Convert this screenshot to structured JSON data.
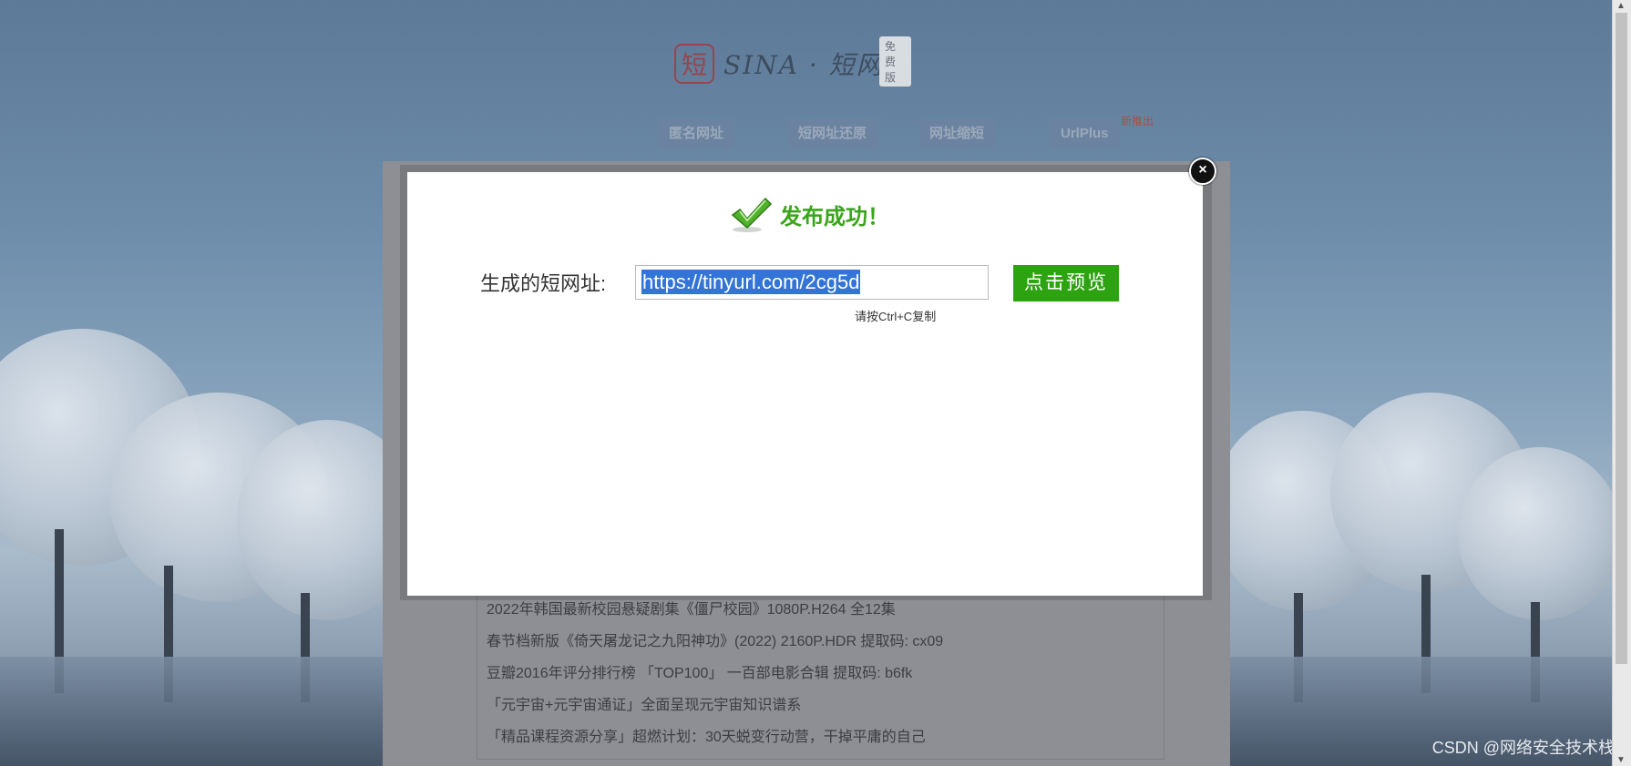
{
  "logo": {
    "mark": "短",
    "text": "SINA · 短网址",
    "badge": "免费版"
  },
  "nav": {
    "items": [
      "匿名网址",
      "短网址还原",
      "网址缩短",
      "UrlPlus"
    ],
    "new_badge": "新推出"
  },
  "modal": {
    "success_text": "发布成功！",
    "url_label": "生成的短网址:",
    "url_value": "https://tinyurl.com/2cg5d",
    "preview_button": "点击预览",
    "copy_hint": "请按Ctrl+C复制",
    "close_symbol": "×"
  },
  "list": {
    "items": [
      "2022年韩国最新校园悬疑剧集《僵尸校园》1080P.H264 全12集",
      "春节档新版《倚天屠龙记之九阳神功》(2022) 2160P.HDR   提取码: cx09",
      "豆瓣2016年评分排行榜 「TOP100」 一百部电影合辑   提取码: b6fk",
      "「元宇宙+元宇宙通证」全面呈现元宇宙知识谱系",
      "「精品课程资源分享」超燃计划：30天蜕变行动营，干掉平庸的自己"
    ]
  },
  "watermark": "CSDN @网络安全技术栈",
  "colors": {
    "success": "#3aa51a",
    "preview_button": "#2ea312",
    "selection": "#3374d6"
  }
}
